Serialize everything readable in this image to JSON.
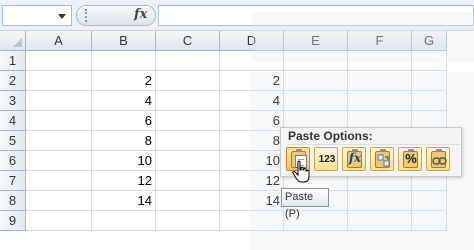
{
  "formula_bar": {
    "name_box": "",
    "fx_symbol": "fx",
    "formula": ""
  },
  "columns": [
    "A",
    "B",
    "C",
    "D",
    "E",
    "F",
    "G"
  ],
  "rows": [
    "1",
    "2",
    "3",
    "4",
    "5",
    "6",
    "7",
    "8",
    "9"
  ],
  "cells": {
    "B2": "2",
    "B3": "4",
    "B4": "6",
    "B5": "8",
    "B6": "10",
    "B7": "12",
    "B8": "14",
    "D2": "2",
    "D3": "4",
    "D4": "6",
    "D5": "8",
    "D6": "10",
    "D7": "12",
    "D8": "14"
  },
  "paste_options": {
    "title": "Paste Options:",
    "buttons": [
      {
        "name": "paste",
        "glyph": ""
      },
      {
        "name": "values",
        "glyph": "123"
      },
      {
        "name": "formulas",
        "glyph": "fx"
      },
      {
        "name": "transpose",
        "glyph": ""
      },
      {
        "name": "formatting",
        "glyph": "%"
      },
      {
        "name": "paste-link",
        "glyph": ""
      }
    ],
    "tooltip": "Paste (P)"
  }
}
